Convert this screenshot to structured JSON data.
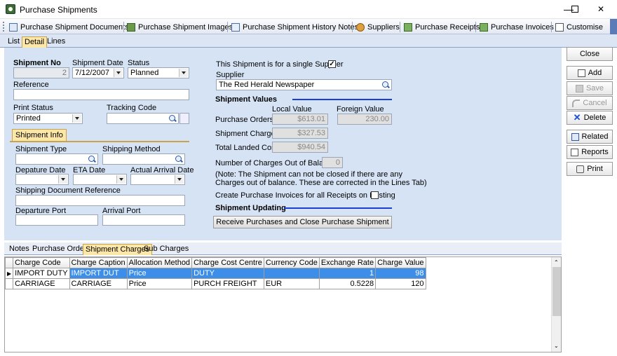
{
  "window": {
    "title": "Purchase Shipments",
    "min": "—",
    "max": "☐",
    "close": "✕"
  },
  "toolbar": [
    {
      "label": "Purchase Shipment Documents",
      "icon": "document-icon"
    },
    {
      "label": "Purchase Shipment Images",
      "icon": "image-icon"
    },
    {
      "label": "Purchase Shipment History Notes",
      "icon": "notes-icon"
    },
    {
      "label": "Suppliers",
      "icon": "person-icon"
    },
    {
      "label": "Purchase Receipts",
      "icon": "receipt-icon"
    },
    {
      "label": "Purchase Invoices",
      "icon": "invoice-icon"
    },
    {
      "label": "Customise",
      "icon": "check-icon"
    }
  ],
  "tabs": {
    "list": "List",
    "detail": "Detail",
    "lines": "Lines"
  },
  "form": {
    "shipment_no_label": "Shipment No",
    "shipment_no": "2",
    "shipment_date_label": "Shipment Date",
    "shipment_date": "7/12/2007",
    "status_label": "Status",
    "status": "Planned",
    "reference_label": "Reference",
    "reference": "",
    "print_status_label": "Print Status",
    "print_status": "Printed",
    "tracking_code_label": "Tracking Code",
    "tracking_code": "",
    "ship_info_tab": "Shipment Info",
    "shipment_type_label": "Shipment Type",
    "shipping_method_label": "Shipping Method",
    "departure_date_label": "Depature Date",
    "eta_date_label": "ETA Date",
    "actual_arrival_label": "Actual Arrival Date",
    "shipping_doc_ref_label": "Shipping Document Reference",
    "departure_port_label": "Departure Port",
    "arrival_port_label": "Arrival Port",
    "single_supplier_label": "This Shipment is for a single Supplier",
    "single_supplier_checked": "✓",
    "supplier_label": "Supplier",
    "supplier": "The Red Herald Newspaper",
    "values_heading": "Shipment Values",
    "local_value_label": "Local Value",
    "foreign_value_label": "Foreign Value",
    "purchase_orders_label": "Purchase Orders",
    "purchase_orders_local": "$613.01",
    "purchase_orders_foreign": "230.00",
    "shipment_charges_label": "Shipment Charges",
    "shipment_charges_local": "$327.53",
    "total_landed_label": "Total Landed Cost",
    "total_landed_local": "$940.54",
    "out_of_balance_label": "Number of Charges Out of Balance",
    "out_of_balance": "0",
    "note_line1": "(Note: The Shipment can not be closed if there are any",
    "note_line2": "Charges out of balance. These are corrected in the Lines Tab)",
    "create_invoices_label": "Create Purchase Invoices for all Receipts on Posting",
    "updating_heading": "Shipment Updating",
    "receive_button": "Receive Purchases and Close Purchase Shipment"
  },
  "buttons": {
    "close": "Close",
    "add": "Add",
    "save": "Save",
    "cancel": "Cancel",
    "delete": "Delete",
    "related": "Related",
    "reports": "Reports",
    "print": "Print"
  },
  "subtabs": {
    "notes": "Notes",
    "purchase_orders": "Purchase Orders",
    "shipment_charges": "Shipment Charges",
    "sub_charges": "Sub Charges"
  },
  "grid": {
    "columns": [
      "Charge Code",
      "Charge Caption",
      "Allocation Method",
      "Charge Cost Centre",
      "Currency Code",
      "Exchange Rate",
      "Charge Value"
    ],
    "rows": [
      [
        "IMPORT DUTY",
        "IMPORT DUT",
        "Price",
        "DUTY",
        "",
        "1",
        "98"
      ],
      [
        "CARRIAGE",
        "CARRIAGE",
        "Price",
        "PURCH FREIGHT",
        "EUR",
        "0.5228",
        "120"
      ]
    ],
    "row_marker": "▶"
  },
  "colors": {
    "panel": "#d5e3f5",
    "accent_line": "#1a3fd6",
    "selected_row": "#3d8ee8",
    "active_tab": "#fce6a8"
  }
}
